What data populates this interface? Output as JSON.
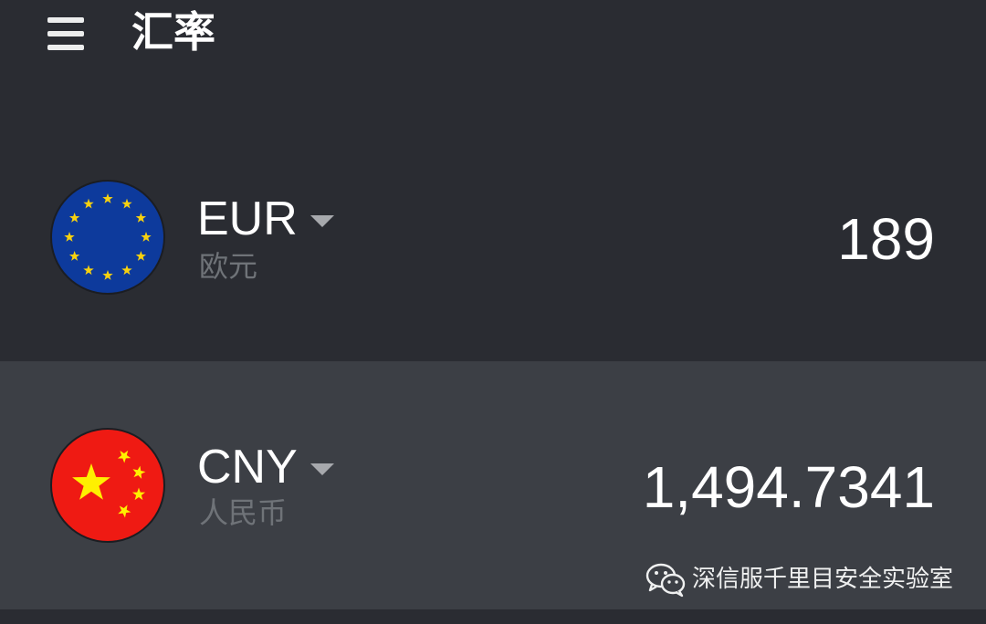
{
  "header": {
    "title": "汇率",
    "menu_icon": "hamburger-menu-icon"
  },
  "currencies": [
    {
      "code": "EUR",
      "name": "欧元",
      "amount": "189",
      "flag_icon": "eu-flag-icon",
      "flag_colors": {
        "background": "#0d3a9c",
        "stars": "#f7d10f"
      }
    },
    {
      "code": "CNY",
      "name": "人民币",
      "amount": "1,494.7341",
      "flag_icon": "china-flag-icon",
      "flag_colors": {
        "background": "#ef1a13",
        "stars": "#fff000"
      }
    }
  ],
  "watermark": {
    "icon": "wechat-icon",
    "text": "深信服千里目安全实验室"
  },
  "colors": {
    "background": "#2a2c32",
    "selected_row": "#3c3f45",
    "secondary_text": "#6f7378",
    "dropdown_arrow": "#a7a9ad"
  }
}
